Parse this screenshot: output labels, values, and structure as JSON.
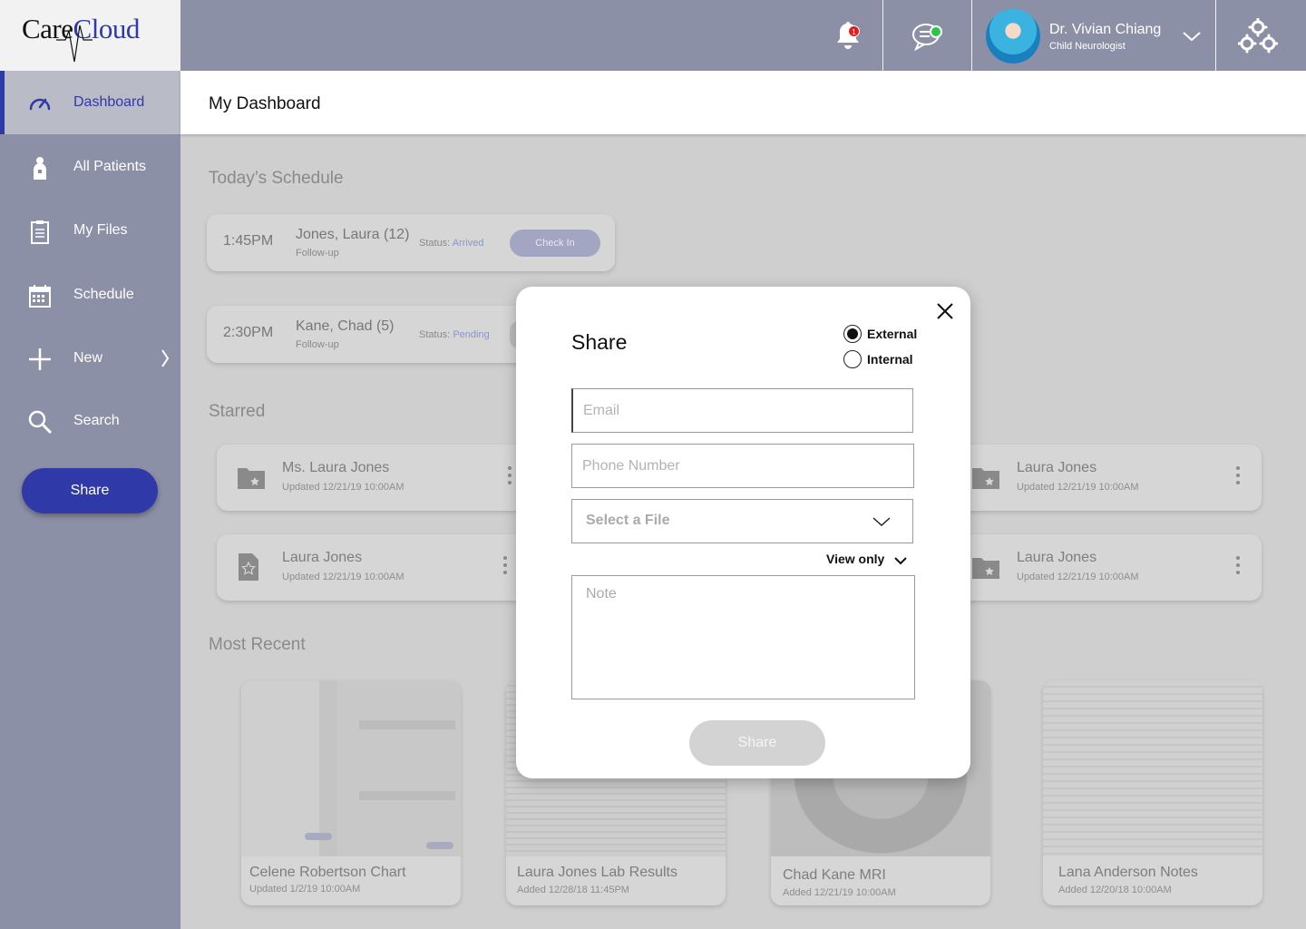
{
  "app": {
    "logo_part1": "Care",
    "logo_part2": "Cloud"
  },
  "sidebar": {
    "items": [
      {
        "label": "Dashboard",
        "icon": "dashboard-gauge-icon"
      },
      {
        "label": "All Patients",
        "icon": "patient-icon"
      },
      {
        "label": "My Files",
        "icon": "clipboard-icon"
      },
      {
        "label": "Schedule",
        "icon": "calendar-icon"
      },
      {
        "label": "New",
        "icon": "plus-icon"
      },
      {
        "label": "Search",
        "icon": "search-icon"
      }
    ],
    "share_label": "Share"
  },
  "header": {
    "notification_count": "1",
    "user_name": "Dr. Vivian Chiang",
    "user_role": "Child Neurologist"
  },
  "page": {
    "title": "My Dashboard"
  },
  "schedule": {
    "title": "Today’s Schedule",
    "appointments": [
      {
        "time": "1:45PM",
        "name": "Jones, Laura (12)",
        "type": "Follow-up",
        "status_label": "Status:",
        "status": "Arrived",
        "action": "Check In"
      },
      {
        "time": "2:30PM",
        "name": "Kane, Chad (5)",
        "type": "Follow-up",
        "status_label": "Status:",
        "status": "Pending"
      }
    ]
  },
  "starred": {
    "title": "Starred",
    "items": [
      {
        "name": "Ms. Laura Jones",
        "updated": "Updated 12/21/19 10:00AM",
        "icon": "starred-folder-icon"
      },
      {
        "name": "Laura Jones",
        "updated": "Updated 12/21/19 10:00AM",
        "icon": "starred-folder-icon"
      },
      {
        "name": "Laura Jones",
        "updated": "Updated 12/21/19 10:00AM",
        "icon": "starred-document-icon"
      },
      {
        "name": "Laura Jones",
        "updated": "Updated 12/21/19 10:00AM",
        "icon": "starred-folder-icon"
      }
    ]
  },
  "recent": {
    "title": "Most Recent",
    "items": [
      {
        "name": "Celene Robertson Chart",
        "date": "Updated 1/2/19 10:00AM"
      },
      {
        "name": "Laura Jones Lab Results",
        "date": "Added 12/28/18 11:45PM"
      },
      {
        "name": "Chad Kane MRI",
        "date": "Added 12/21/19 10:00AM"
      },
      {
        "name": "Lana Anderson Notes",
        "date": "Added 12/20/18 10:00AM"
      }
    ]
  },
  "modal": {
    "title": "Share",
    "radio_options": [
      {
        "label": "External",
        "selected": true
      },
      {
        "label": "Internal",
        "selected": false
      }
    ],
    "email_placeholder": "Email",
    "phone_placeholder": "Phone Number",
    "file_select_label": "Select a File",
    "permission": "View only",
    "note_placeholder": "Note",
    "share_label": "Share"
  },
  "colors": {
    "brand": "#2f3aa8",
    "sidebar": "#8c90a6",
    "badge": "#e21f1f",
    "online": "#2ec44a"
  }
}
